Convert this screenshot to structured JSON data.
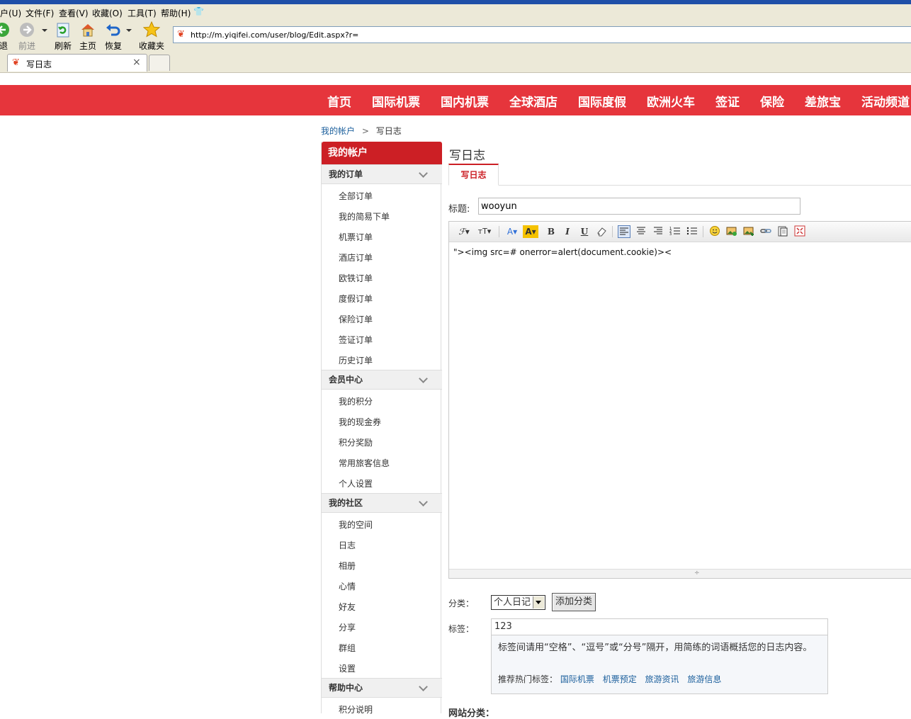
{
  "browser": {
    "menu": [
      "户(U)",
      "文件(F)",
      "查看(V)",
      "收藏(O)",
      "工具(T)",
      "帮助(H)"
    ],
    "toolbar": {
      "back": "退",
      "forward": "前进",
      "refresh": "刷新",
      "home": "主页",
      "restore": "恢复",
      "favorites": "收藏夹"
    },
    "address": "http://m.yiqifei.com/user/blog/Edit.aspx?r=",
    "tab_title": "写日志",
    "tab_close": "×"
  },
  "nav": [
    "首页",
    "国际机票",
    "国内机票",
    "全球酒店",
    "国际度假",
    "欧洲火车",
    "签证",
    "保险",
    "差旅宝",
    "活动频道"
  ],
  "breadcrumb": {
    "account": "我的帐户",
    "sep": ">",
    "current": "写日志"
  },
  "sidebar": {
    "title": "我的帐户",
    "sections": [
      {
        "title": "我的订单",
        "items": [
          "全部订单",
          "我的简易下单",
          "机票订单",
          "酒店订单",
          "欧铁订单",
          "度假订单",
          "保险订单",
          "签证订单",
          "历史订单"
        ]
      },
      {
        "title": "会员中心",
        "items": [
          "我的积分",
          "我的现金券",
          "积分奖励",
          "常用旅客信息",
          "个人设置"
        ]
      },
      {
        "title": "我的社区",
        "items": [
          "我的空间",
          "日志",
          "相册",
          "心情",
          "好友",
          "分享",
          "群组",
          "设置"
        ]
      },
      {
        "title": "帮助中心",
        "items": [
          "积分说明"
        ]
      }
    ]
  },
  "main": {
    "page_title": "写日志",
    "tab": "写日志",
    "title_label": "标题:",
    "title_value": "wooyun",
    "editor_content": "\"><img src=# onerror=alert(document.cookie)><",
    "category_label": "分类：",
    "category_value": "个人日记",
    "add_category": "添加分类",
    "tags_label": "标签：",
    "tags_value": "123",
    "tags_tip": "标签间请用“空格”、“逗号”或“分号”隔开，用简练的词语概括您的日志内容。",
    "hot_tags_label": "推荐热门标签：",
    "hot_tags": [
      "国际机票",
      "机票预定",
      "旅游资讯",
      "旅游信息"
    ],
    "site_category": "网站分类："
  },
  "colors": {
    "brand_red": "#e6353c",
    "sidebar_red": "#cc1f25",
    "link": "#1b5f9c"
  }
}
